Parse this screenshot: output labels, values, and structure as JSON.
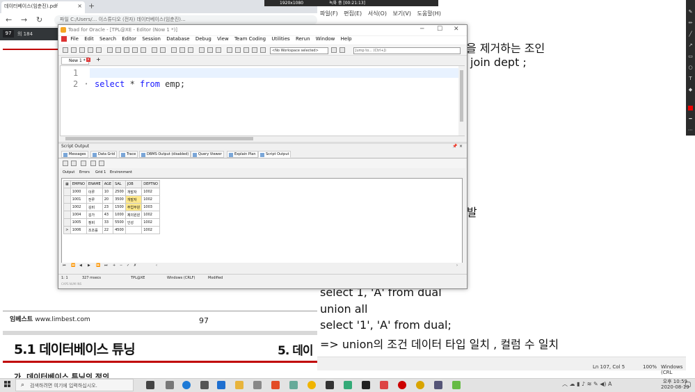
{
  "pdf": {
    "tab_title": "데이터베이스(임춘진).pdf",
    "tab_close": "×",
    "new_tab": "+",
    "url": "파일   C:/Users/... 이스튜디오 (전자) 데이터베이스(임춘진)...",
    "page_current": "97",
    "page_total": "의 184",
    "footer_site_bold": "임베스트",
    "footer_site": "www.limbest.com",
    "page_number": "97",
    "section_title": "5.1 데이터베이스 튜닝",
    "section_title_right": "5. 데이",
    "sub_heading": "가. 데이터베이스 튜닝의 정의"
  },
  "recorder": {
    "resolution": "1920x1080",
    "status": "녹화 중 [00:21:13]"
  },
  "notepad": {
    "menu": [
      "파일(F)",
      "편집(E)",
      "서식(O)",
      "보기(V)",
      "도움말(H)"
    ],
    "lines": [
      "을 제거하는 조인",
      "join dept  ;",
      "발",
      "select 1, 'A' from dual",
      "union all",
      "select '1', 'A' from dual;",
      "=> union의 조건 데이터 타입 일치 , 컬럼 수 일치"
    ],
    "status_pos": "Ln 107, Col 5",
    "status_zoom": "100%",
    "status_eol": "Windows (CRL"
  },
  "toad": {
    "title": "Toad for Oracle - [TPL@XE - Editor (Now 1 *)]",
    "menu": [
      "File",
      "Edit",
      "Search",
      "Editor",
      "Session",
      "Database",
      "Debug",
      "View",
      "Team Coding",
      "Utilities",
      "Rerun",
      "Window",
      "Help"
    ],
    "workspace": "<No Workspace selected>",
    "jump": "Jump to... (Ctrl+J)",
    "doc_tab": "New 1 *",
    "line_numbers": [
      "1",
      "2"
    ],
    "sql_kw1": "select",
    "sql_mid": " * ",
    "sql_kw2": "from",
    "sql_rest": " emp;",
    "script_output_label": "Script Output",
    "output_tabs": [
      "Messages",
      "Data Grid",
      "Trace",
      "DBMS Output (disabled)",
      "Query Viewer",
      "Explain Plan",
      "Script Output"
    ],
    "sub_tabs": [
      "Output",
      "Errors",
      "Grid 1",
      "Environment"
    ],
    "grid": {
      "columns": [
        "EMPNO",
        "ENAME",
        "AGE",
        "SAL",
        "JOB",
        "DEPTNO"
      ],
      "rows": [
        [
          "1000",
          "이루",
          "10",
          "2500",
          "개발자",
          "1002"
        ],
        [
          "1001",
          "전루",
          "20",
          "3500",
          "개발자",
          "1002"
        ],
        [
          "1002",
          "김비",
          "23",
          "1500",
          "주업무원",
          "1003"
        ],
        [
          "1004",
          "김가",
          "43",
          "1000",
          "제의원원",
          "1002"
        ],
        [
          "1005",
          "정비",
          "33",
          "5500",
          "인성",
          "1002"
        ],
        [
          "1006",
          "조조를",
          "22",
          "4500",
          "",
          "1002"
        ]
      ],
      "current_row_marker": ">"
    },
    "status": {
      "pos": "1:  1",
      "time": "327 msecs",
      "conn": "TPL@XE",
      "eol": "Windows (CRLF)",
      "state": "Modified",
      "caps": "CAPS  NUM  INS"
    }
  },
  "taskbar": {
    "search_placeholder": "검색하려면 여기에 입력하십시오.",
    "time": "오후 10:59",
    "date": "2020-08-19"
  }
}
